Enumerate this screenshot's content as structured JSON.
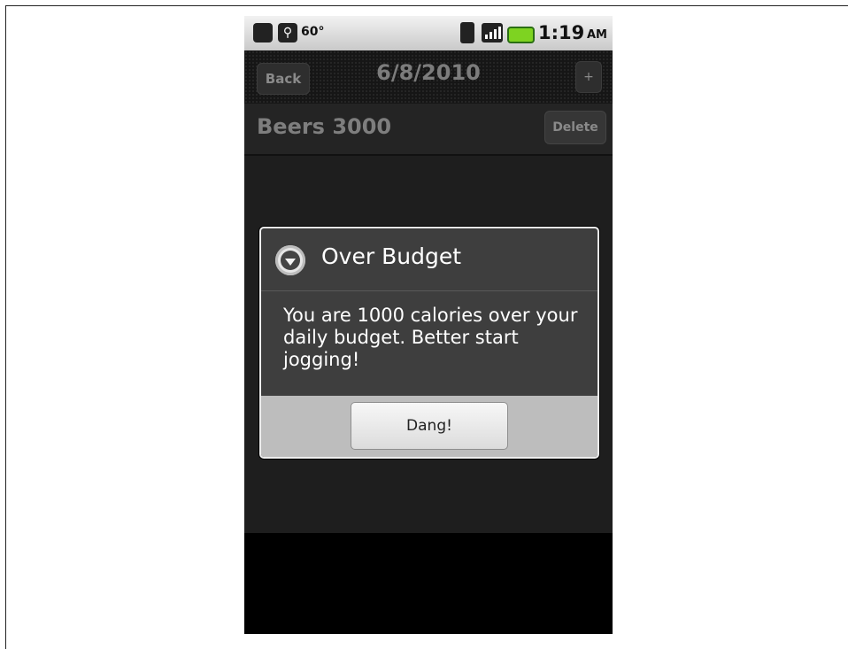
{
  "status_bar": {
    "temperature": "60°",
    "time": "1:19",
    "ampm": "AM"
  },
  "app_bar": {
    "back_label": "Back",
    "title": "6/8/2010",
    "add_label": "+"
  },
  "item": {
    "name": "Beers 3000",
    "delete_label": "Delete"
  },
  "dialog": {
    "title": "Over Budget",
    "message": "You are 1000 calories over your daily budget. Better start jogging!",
    "button_label": "Dang!"
  }
}
